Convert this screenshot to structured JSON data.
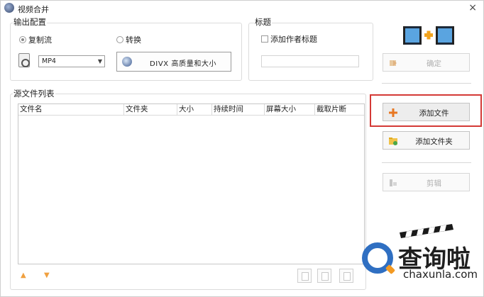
{
  "window": {
    "title": "视频合并",
    "close_glyph": "×"
  },
  "output": {
    "group_label": "输出配置",
    "radio_copy": "复制流",
    "radio_convert": "转换",
    "format_value": "MP4",
    "preset_label": "DIVX 高质量和大小"
  },
  "title_group": {
    "label": "标题",
    "checkbox_label": "添加作者标题",
    "input_value": ""
  },
  "actions": {
    "confirm": "确定",
    "add_file": "添加文件",
    "add_folder": "添加文件夹",
    "cut": "剪辑"
  },
  "source_list": {
    "label": "源文件列表",
    "columns": [
      "文件名",
      "文件夹",
      "大小",
      "持续时间",
      "屏幕大小",
      "截取片断"
    ]
  },
  "watermark": {
    "brand": "查询啦",
    "domain": "chaxunla.com"
  },
  "colors": {
    "highlight": "#d43a36",
    "watermark_blue": "#2f6fc2",
    "watermark_orange": "#f39a23"
  }
}
